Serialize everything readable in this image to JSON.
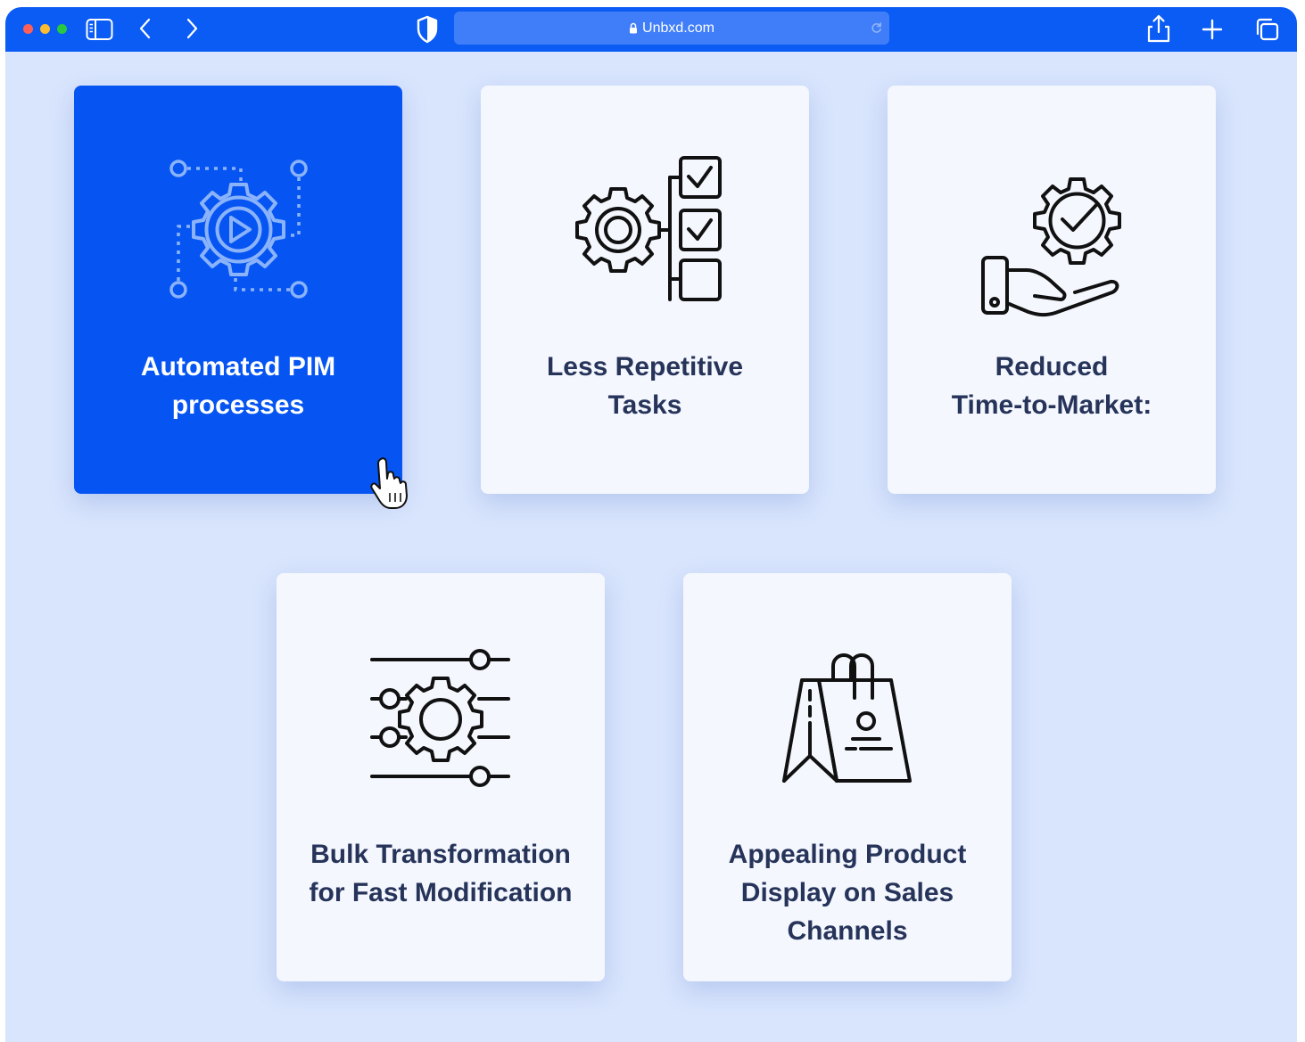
{
  "browser": {
    "url": "Unbxd.com",
    "colors": {
      "toolbar": "#0b5cf5",
      "url_bar": "#3f7ef8",
      "content_bg": "#d9e5fd"
    },
    "icons": [
      "sidebar-icon",
      "back-icon",
      "forward-icon",
      "shield-icon",
      "lock-icon",
      "reload-icon",
      "share-icon",
      "plus-icon",
      "tabs-icon"
    ]
  },
  "cards": [
    {
      "title_line1": "Automated PIM",
      "title_line2": "processes",
      "icon": "gear-play-icon",
      "active": true
    },
    {
      "title_line1": "Less Repetitive",
      "title_line2": "Tasks",
      "icon": "gear-checklist-icon",
      "active": false
    },
    {
      "title_line1": "Reduced",
      "title_line2": "Time-to-Market:",
      "icon": "hand-gear-check-icon",
      "active": false
    },
    {
      "title_line1": "Bulk Transformation",
      "title_line2": "for Fast Modification",
      "icon": "gear-sliders-icon",
      "active": false
    },
    {
      "title_line1": "Appealing Product",
      "title_line2": "Display on Sales",
      "title_line3": "Channels",
      "icon": "shopping-bag-icon",
      "active": false
    }
  ],
  "colors": {
    "active_card": "#0655f2",
    "card": "#f4f7fe",
    "title_text": "#27345a"
  }
}
